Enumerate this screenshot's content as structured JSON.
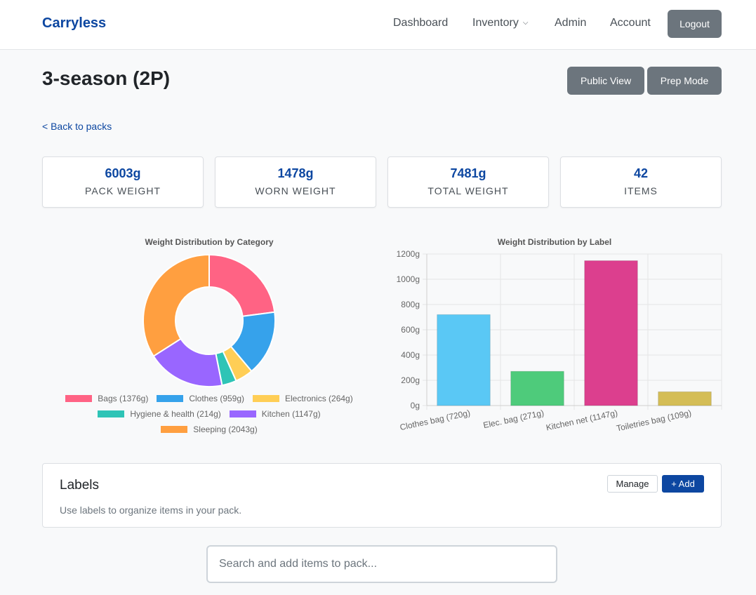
{
  "nav": {
    "brand": "Carryless",
    "links": [
      "Dashboard",
      "Inventory",
      "Admin",
      "Account"
    ],
    "logout": "Logout"
  },
  "page": {
    "title": "3-season (2P)",
    "public_view": "Public View",
    "prep_mode": "Prep Mode",
    "back_link": "< Back to packs"
  },
  "stats": [
    {
      "value": "6003g",
      "label": "PACK WEIGHT"
    },
    {
      "value": "1478g",
      "label": "WORN WEIGHT"
    },
    {
      "value": "7481g",
      "label": "TOTAL WEIGHT"
    },
    {
      "value": "42",
      "label": "ITEMS"
    }
  ],
  "labels_card": {
    "title": "Labels",
    "description": "Use labels to organize items in your pack.",
    "manage": "Manage",
    "add": "+ Add"
  },
  "search": {
    "placeholder": "Search and add items to pack..."
  },
  "chart_data": [
    {
      "type": "pie",
      "title": "Weight Distribution by Category",
      "donut": true,
      "legend": "bottom",
      "slices": [
        {
          "label": "Bags (1376g)",
          "value": 1376,
          "color": "#ff6384"
        },
        {
          "label": "Clothes (959g)",
          "value": 959,
          "color": "#36a2eb"
        },
        {
          "label": "Electronics (264g)",
          "value": 264,
          "color": "#ffce56"
        },
        {
          "label": "Hygiene & health (214g)",
          "value": 214,
          "color": "#2ec4b6"
        },
        {
          "label": "Kitchen (1147g)",
          "value": 1147,
          "color": "#9966ff"
        },
        {
          "label": "Sleeping (2043g)",
          "value": 2043,
          "color": "#ff9f40"
        }
      ]
    },
    {
      "type": "bar",
      "title": "Weight Distribution by Label",
      "categories": [
        "Clothes bag (720g)",
        "Elec. bag (271g)",
        "Kitchen net (1147g)",
        "Toiletries bag (109g)"
      ],
      "values": [
        720,
        271,
        1147,
        109
      ],
      "colors": [
        "#5ac8f5",
        "#4ecb7b",
        "#dc3f8e",
        "#d4bd56"
      ],
      "yticks": [
        "0g",
        "200g",
        "400g",
        "600g",
        "800g",
        "1000g",
        "1200g"
      ],
      "ylim": [
        0,
        1200
      ],
      "grid": true
    }
  ]
}
